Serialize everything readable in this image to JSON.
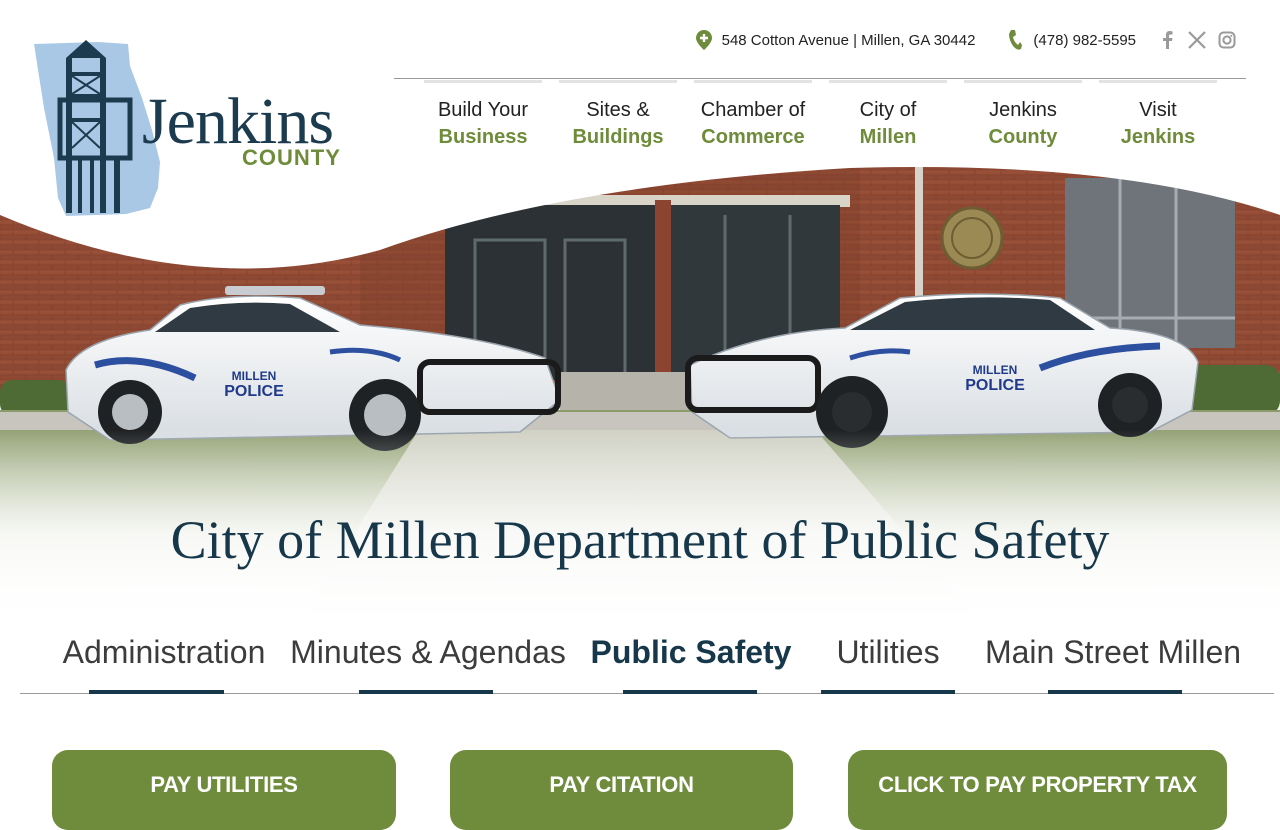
{
  "contact": {
    "address": "548 Cotton Avenue | Millen, GA 30442",
    "phone": "(478) 982-5595",
    "icons": [
      "map-pin-icon",
      "phone-icon",
      "facebook-icon",
      "x-icon",
      "instagram-icon"
    ]
  },
  "logo": {
    "word": "Jenkins",
    "sub": "COUNTY"
  },
  "nav": [
    {
      "line1": "Build Your",
      "line2": "Business"
    },
    {
      "line1": "Sites &",
      "line2": "Buildings"
    },
    {
      "line1": "Chamber of",
      "line2": "Commerce"
    },
    {
      "line1": "City of",
      "line2": "Millen"
    },
    {
      "line1": "Jenkins",
      "line2": "County"
    },
    {
      "line1": "Visit",
      "line2": "Jenkins"
    }
  ],
  "hero": {
    "title": "City of Millen Department of Public Safety",
    "car_door_line1": "MILLEN",
    "car_door_line2": "POLICE"
  },
  "subnav": {
    "items": [
      "Administration",
      "Minutes & Agendas",
      "Public Safety",
      "Utilities",
      "Main Street Millen"
    ],
    "active": "Public Safety"
  },
  "buttons": {
    "pay_utilities": "PAY UTILITIES",
    "pay_citation": "PAY CITATION",
    "pay_property_tax": "CLICK TO PAY PROPERTY TAX"
  },
  "colors": {
    "brand_green": "#6f8c3c",
    "brand_navy": "#17384a",
    "logo_blue": "#a9c8e6"
  }
}
